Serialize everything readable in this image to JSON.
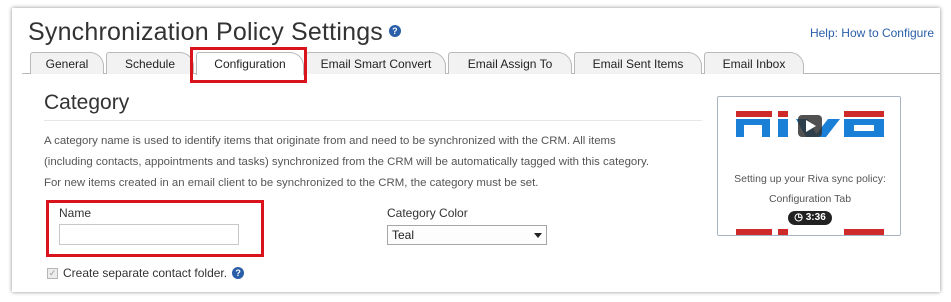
{
  "page": {
    "title": "Synchronization Policy Settings",
    "help_link": "Help: How to Configure"
  },
  "tabs": [
    {
      "label": "General"
    },
    {
      "label": "Schedule"
    },
    {
      "label": "Configuration",
      "active": true
    },
    {
      "label": "Email Smart Convert"
    },
    {
      "label": "Email Assign To"
    },
    {
      "label": "Email Sent Items"
    },
    {
      "label": "Email Inbox"
    }
  ],
  "category": {
    "heading": "Category",
    "description_lines": [
      "A category name is used to identify items that originate from and need to be synchronized with the CRM. All items",
      "(including contacts, appointments and tasks) synchronized from the CRM will be automatically tagged with this category.",
      "For new items created in an email client to be synchronized to the CRM, the category must be set."
    ],
    "name_label": "Name",
    "name_value": "",
    "color_label": "Category Color",
    "color_value": "Teal",
    "checkbox_label": "Create separate contact folder.",
    "checkbox_checked": true
  },
  "video": {
    "brand": "riva",
    "caption_line1": "Setting up your Riva sync policy:",
    "caption_line2": "Configuration Tab",
    "duration": "3:36"
  },
  "colors": {
    "link": "#2a5ea8",
    "highlight": "#d9121c",
    "brand_blue": "#1a7fd6"
  }
}
